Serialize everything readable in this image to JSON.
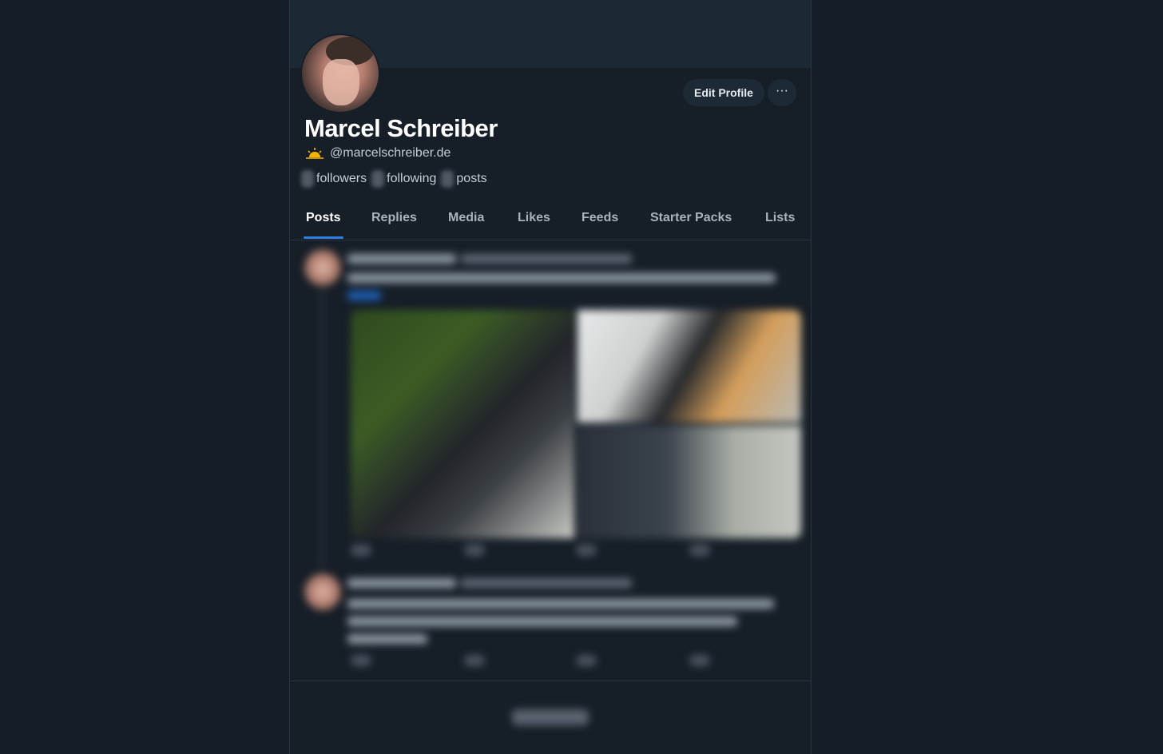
{
  "profile": {
    "display_name": "Marcel Schreiber",
    "handle": "@marcelschreiber.de",
    "edit_label": "Edit Profile",
    "more_label": "···",
    "stats": {
      "followers_label": "followers",
      "following_label": "following",
      "posts_label": "posts"
    }
  },
  "tabs": [
    {
      "label": "Posts",
      "active": true
    },
    {
      "label": "Replies"
    },
    {
      "label": "Media"
    },
    {
      "label": "Likes"
    },
    {
      "label": "Feeds"
    },
    {
      "label": "Starter Packs"
    },
    {
      "label": "Lists"
    }
  ],
  "colors": {
    "background": "#151d28",
    "column": "#161e27",
    "accent": "#2f7ee6",
    "sun": "#f5b400"
  },
  "icons": {
    "sun": "sunrise-icon",
    "more": "ellipsis-icon"
  }
}
